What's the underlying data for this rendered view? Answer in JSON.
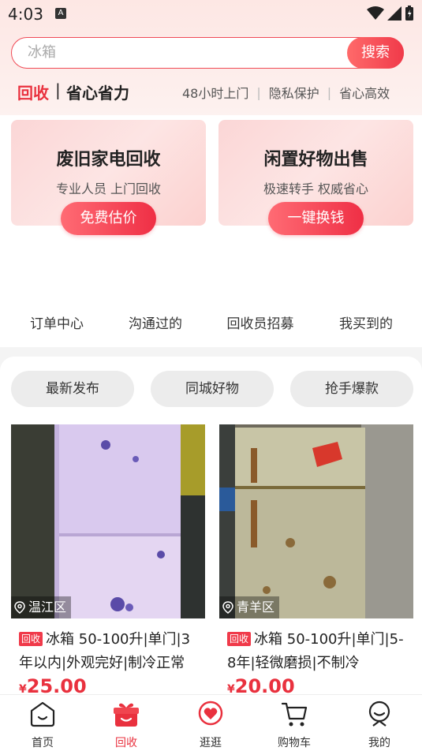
{
  "status_bar": {
    "time": "4:03",
    "notif_letter": "A"
  },
  "search": {
    "placeholder": "冰箱",
    "button_label": "搜索"
  },
  "slogan": {
    "highlight": "回收",
    "separator": "|",
    "tagline": "省心省力",
    "features": [
      "48小时上门",
      "隐私保护",
      "省心高效"
    ]
  },
  "promos": [
    {
      "title": "废旧家电回收",
      "subtitle": "专业人员 上门回收",
      "button": "免费估价"
    },
    {
      "title": "闲置好物出售",
      "subtitle": "极速转手 权威省心",
      "button": "一键换钱"
    }
  ],
  "quick_nav": [
    "订单中心",
    "沟通过的",
    "回收员招募",
    "我买到的"
  ],
  "filters": [
    "最新发布",
    "同城好物",
    "抢手爆款"
  ],
  "products": [
    {
      "tag": "回收",
      "title": "冰箱 50-100升|单门|3年以内|外观完好|制冷正常",
      "location": "温江区",
      "price": "25.00",
      "currency": "¥"
    },
    {
      "tag": "回收",
      "title": "冰箱 50-100升|单门|5-8年|轻微磨损|不制冷",
      "location": "青羊区",
      "price": "20.00",
      "currency": "¥"
    }
  ],
  "bottom_nav": [
    {
      "label": "首页",
      "icon": "home-face-icon"
    },
    {
      "label": "回收",
      "icon": "gift-box-icon",
      "active": true
    },
    {
      "label": "逛逛",
      "icon": "heart-bubble-icon"
    },
    {
      "label": "购物车",
      "icon": "cart-icon"
    },
    {
      "label": "我的",
      "icon": "user-smile-icon"
    }
  ],
  "colors": {
    "accent": "#e9313e",
    "pill_bg": "#ececec"
  }
}
